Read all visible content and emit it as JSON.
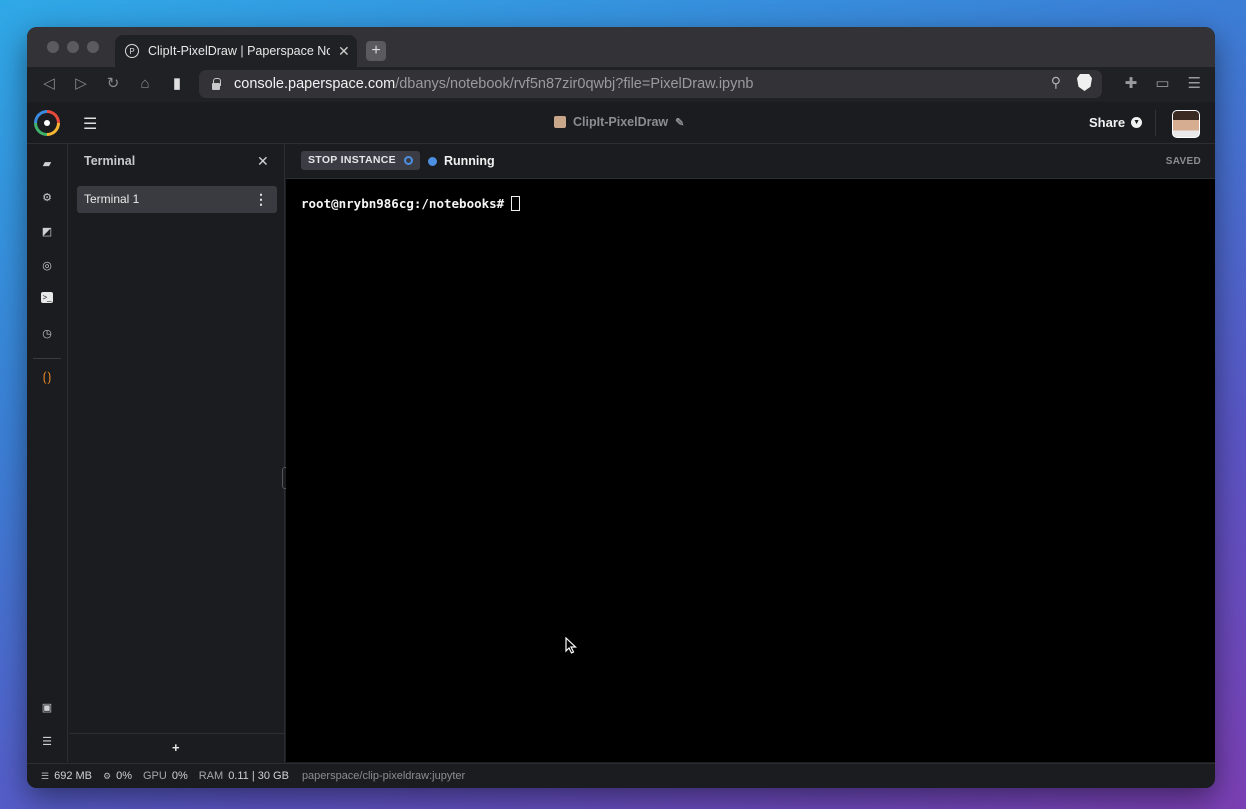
{
  "browser": {
    "tab_title": "ClipIt-PixelDraw | Paperspace Notebook",
    "tab_close": "✕",
    "new_tab": "+",
    "url_host": "console.paperspace.com",
    "url_path": "/dbanys/notebook/rvf5n87zir0qwbj?file=PixelDraw.ipynb"
  },
  "header": {
    "notebook_title": "ClipIt-PixelDraw",
    "share_label": "Share"
  },
  "rail": {
    "icons": [
      "folder-icon",
      "cpu-icon",
      "chart-icon",
      "search-file-icon",
      "terminal-icon",
      "clock-icon",
      "jupyter-icon",
      "gallery-settings-icon",
      "database-icon"
    ]
  },
  "sidebar": {
    "title": "Terminal",
    "close": "✕",
    "items": [
      {
        "label": "Terminal 1"
      }
    ],
    "add": "+"
  },
  "main": {
    "stop_label": "STOP INSTANCE",
    "status_label": "Running",
    "saved_label": "SAVED",
    "status_color": "#4d8fe0"
  },
  "terminal": {
    "prompt": "root@nrybn986cg:/notebooks#"
  },
  "statusbar": {
    "storage": "692 MB",
    "cpu": "0%",
    "gpu_label": "GPU",
    "gpu": "0%",
    "ram_label": "RAM",
    "ram": "0.11 | 30 GB",
    "image": "paperspace/clip-pixeldraw:jupyter"
  }
}
